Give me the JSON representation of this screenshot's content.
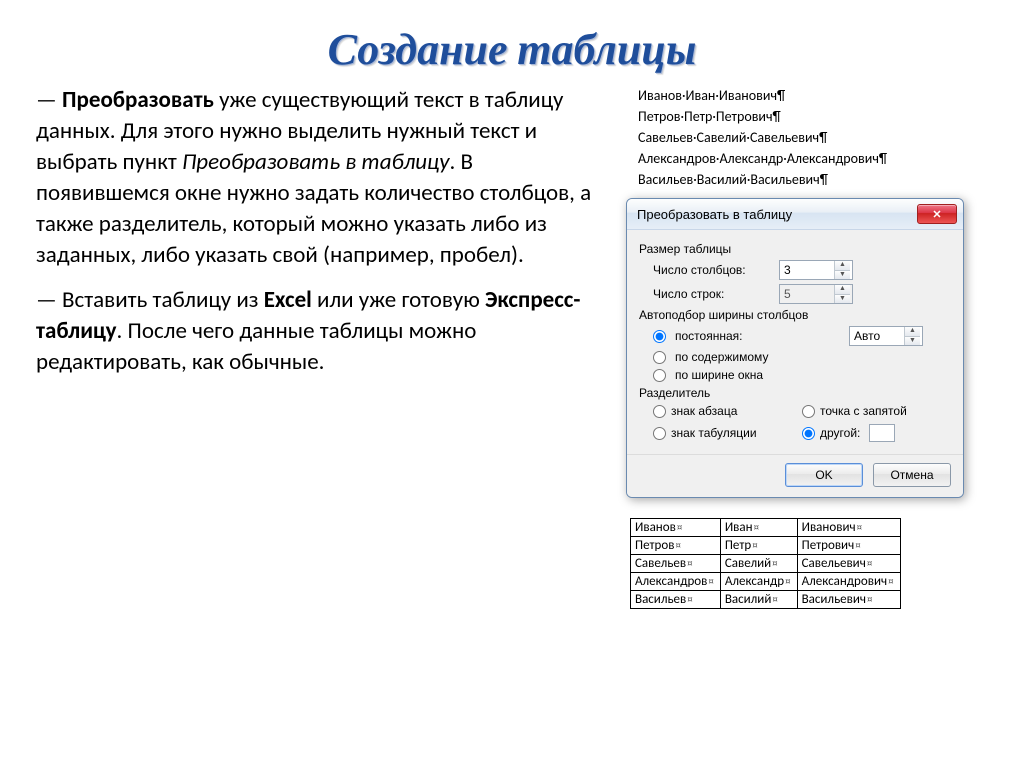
{
  "title": "Создание таблицы",
  "para1_pre": "— ",
  "para1_bold": "Преобразовать",
  "para1_mid": " уже существующий текст в таблицу данных. Для этого нужно выделить нужный текст и выбрать пункт ",
  "para1_italic": "Преобразовать в таблицу",
  "para1_post": ". В появившемся окне нужно задать количество столбцов, а также разделитель, который  можно указать либо из заданных, либо указать свой (например, пробел).",
  "para2_pre": "— Вставить таблицу из ",
  "para2_b1": "Excel",
  "para2_mid": " или уже готовую ",
  "para2_b2": "Экспресс-таблицу",
  "para2_post": ". После чего данные таблицы можно редактировать, как обычные.",
  "raw_lines": [
    "Иванов·Иван·Иванович",
    "Петров·Петр·Петрович",
    "Савельев·Савелий·Савельевич",
    "Александров·Александр·Александрович",
    "Васильев·Василий·Васильевич"
  ],
  "dialog": {
    "title": "Преобразовать в таблицу",
    "size_label": "Размер таблицы",
    "cols_label": "Число столбцов:",
    "cols_value": "3",
    "rows_label": "Число строк:",
    "rows_value": "5",
    "autofit_label": "Автоподбор ширины столбцов",
    "fixed_label": "постоянная:",
    "fixed_value": "Авто",
    "content_label": "по содержимому",
    "window_label": "по ширине окна",
    "sep_label": "Разделитель",
    "sep_para": "знак абзаца",
    "sep_semicolon": "точка с запятой",
    "sep_tab": "знак табуляции",
    "sep_other": "другой:",
    "ok": "OK",
    "cancel": "Отмена"
  },
  "table_rows": [
    [
      "Иванов",
      "Иван",
      "Иванович"
    ],
    [
      "Петров",
      "Петр",
      "Петрович"
    ],
    [
      "Савельев",
      "Савелий",
      "Савельевич"
    ],
    [
      "Александров",
      "Александр",
      "Александрович"
    ],
    [
      "Васильев",
      "Василий",
      "Васильевич"
    ]
  ]
}
